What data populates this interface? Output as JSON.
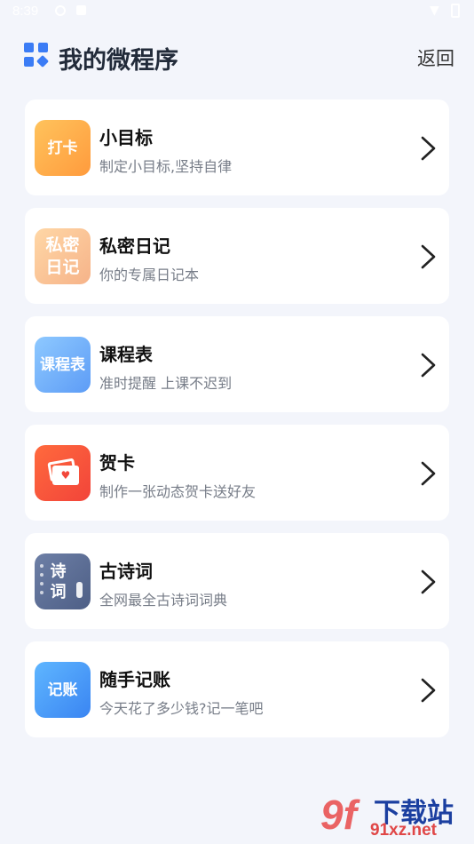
{
  "status_bar": {
    "time": "8:39",
    "battery": "0"
  },
  "header": {
    "title": "我的微程序",
    "back_label": "返回"
  },
  "items": [
    {
      "icon_text": "打卡",
      "title": "小目标",
      "subtitle": "制定小目标,坚持自律"
    },
    {
      "icon_text": "私密日记",
      "title": "私密日记",
      "subtitle": "你的专属日记本"
    },
    {
      "icon_text": "课程表",
      "title": "课程表",
      "subtitle": "准时提醒 上课不迟到"
    },
    {
      "icon_text": "",
      "title": "贺卡",
      "subtitle": "制作一张动态贺卡送好友"
    },
    {
      "icon_text": "诗词",
      "title": "古诗词",
      "subtitle": "全网最全古诗词词典"
    },
    {
      "icon_text": "记账",
      "title": "随手记账",
      "subtitle": "今天花了多少钱?记一笔吧"
    }
  ],
  "icons": {
    "header": "apps-grid-icon",
    "chevron": "chevron-right-icon"
  },
  "colors": {
    "background": "#f3f5fb",
    "accent": "#3b7cf5",
    "card": "#ffffff"
  },
  "watermark": {
    "logo": "9f",
    "name": "下载站",
    "url": "91xz.net"
  }
}
